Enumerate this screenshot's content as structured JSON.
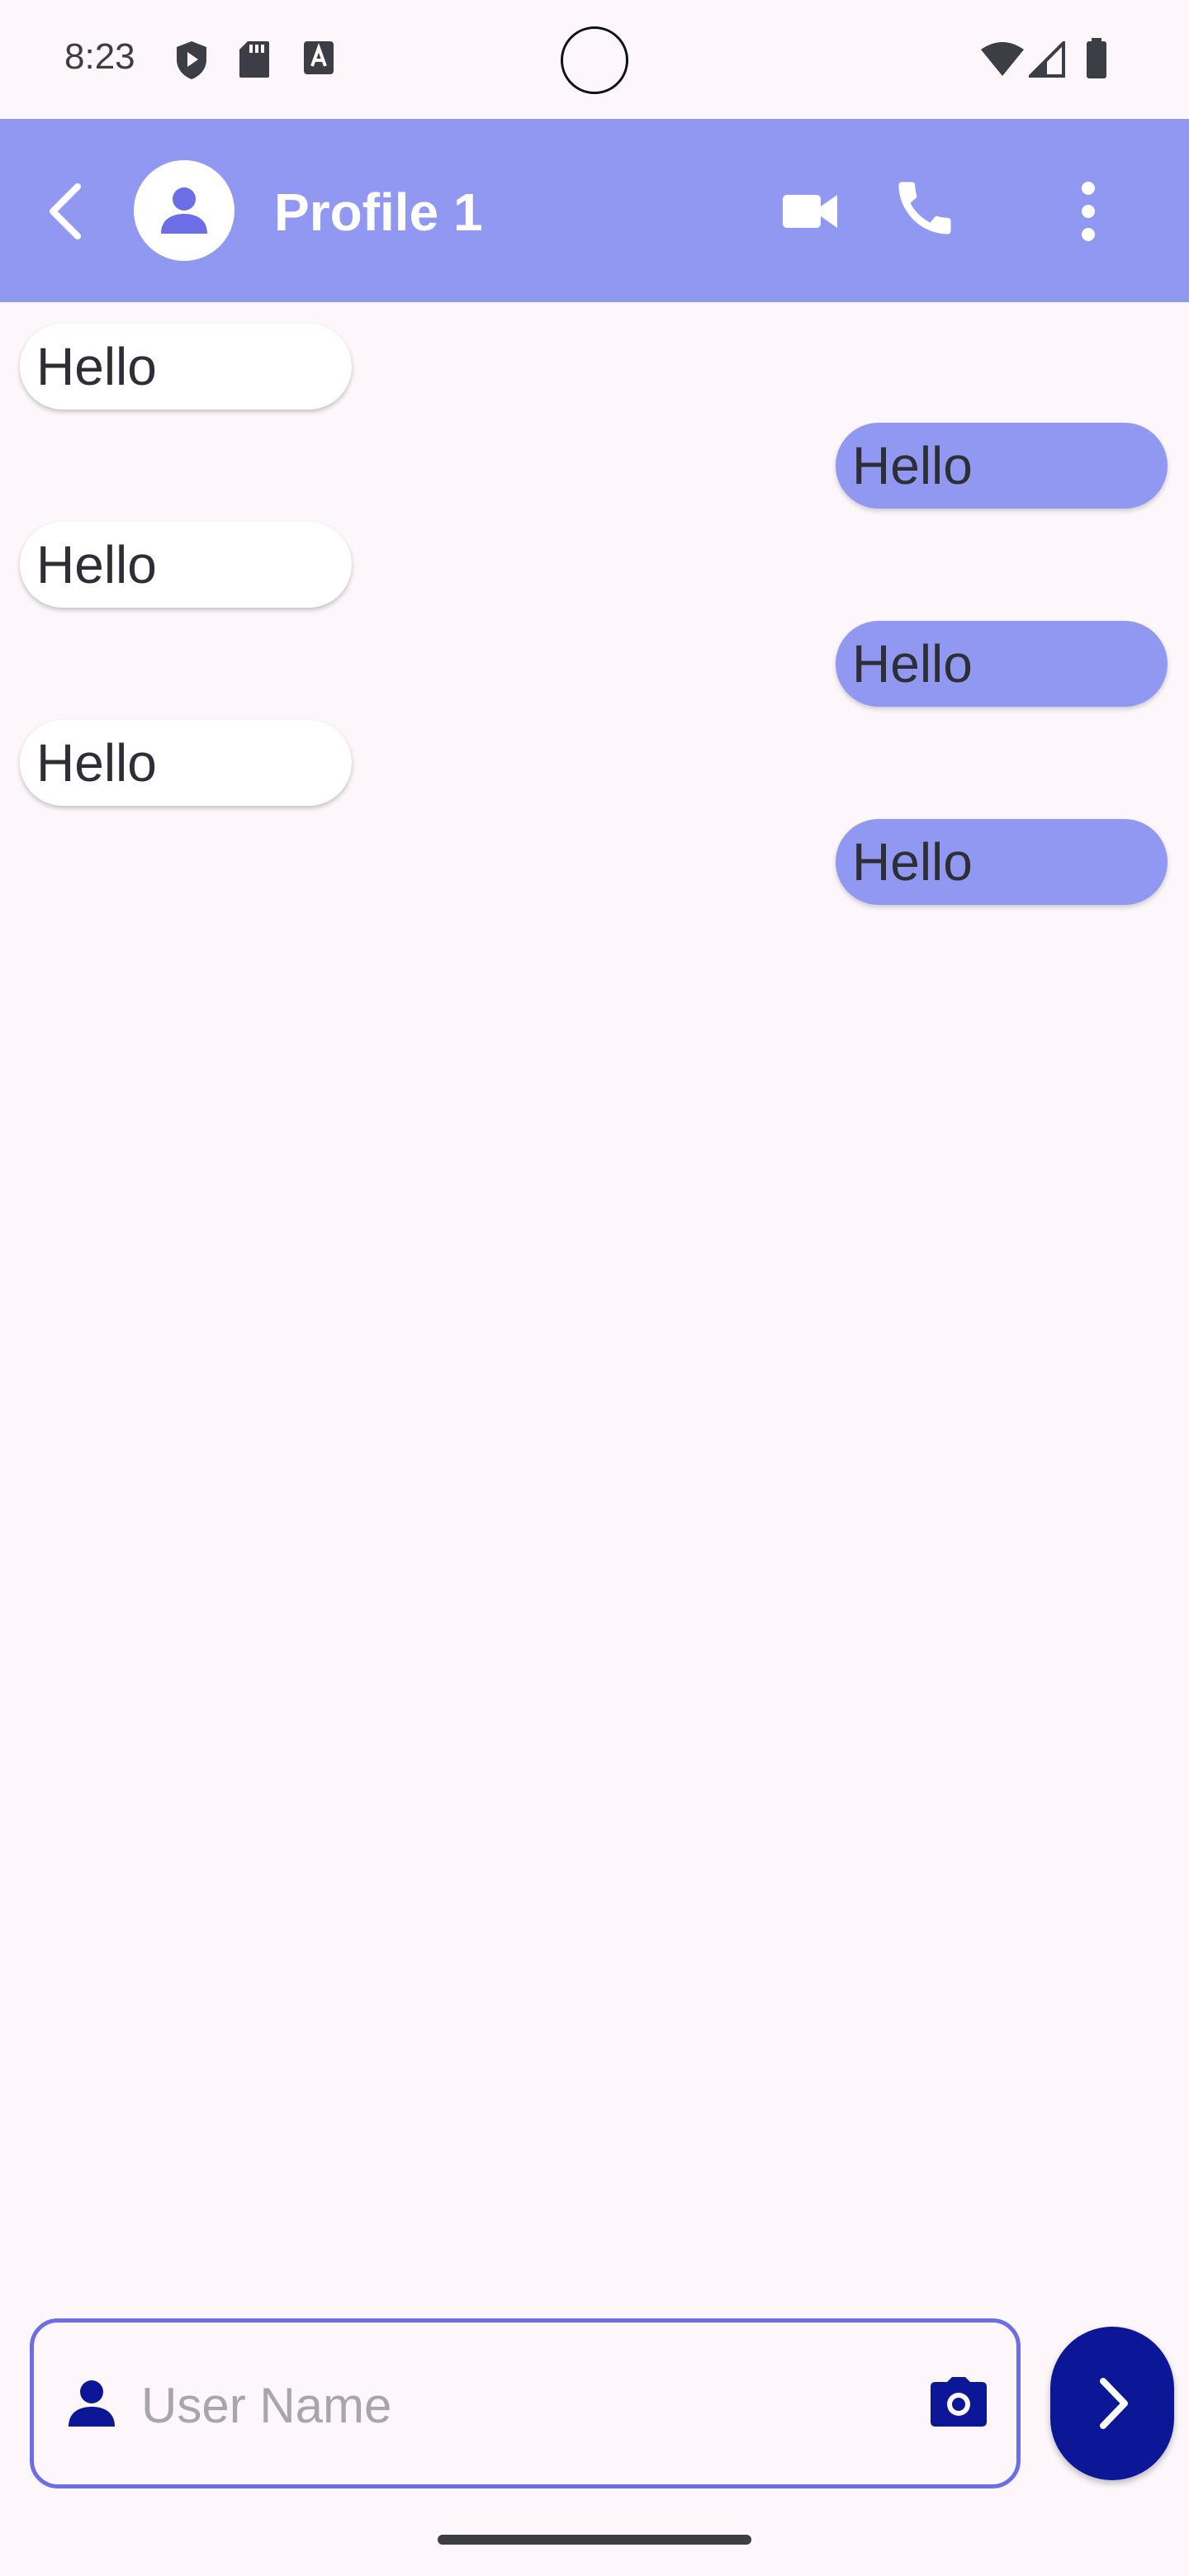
{
  "status_bar": {
    "time": "8:23",
    "left_icons": [
      "shield-play-icon",
      "sd-card-icon",
      "font-a-icon"
    ],
    "right_icons": [
      "wifi-icon",
      "cell-signal-icon",
      "battery-icon"
    ]
  },
  "app_bar": {
    "title": "Profile 1",
    "icons": {
      "back": "chevron-left-icon",
      "avatar": "person-icon",
      "video": "videocam-icon",
      "call": "phone-icon",
      "menu": "more-vertical-icon"
    }
  },
  "messages": [
    {
      "direction": "incoming",
      "text": "Hello"
    },
    {
      "direction": "outgoing",
      "text": "Hello"
    },
    {
      "direction": "incoming",
      "text": "Hello"
    },
    {
      "direction": "outgoing",
      "text": "Hello"
    },
    {
      "direction": "incoming",
      "text": "Hello"
    },
    {
      "direction": "outgoing",
      "text": "Hello"
    }
  ],
  "composer": {
    "placeholder": "User Name",
    "value": "",
    "leading_icon": "person-icon",
    "trailing_icon": "camera-icon",
    "send_icon": "chevron-right-icon"
  },
  "colors": {
    "accent": "#9198f2",
    "primary_dark": "#0b1796",
    "outline": "#6b6ee6",
    "background": "#fdf7fb"
  }
}
